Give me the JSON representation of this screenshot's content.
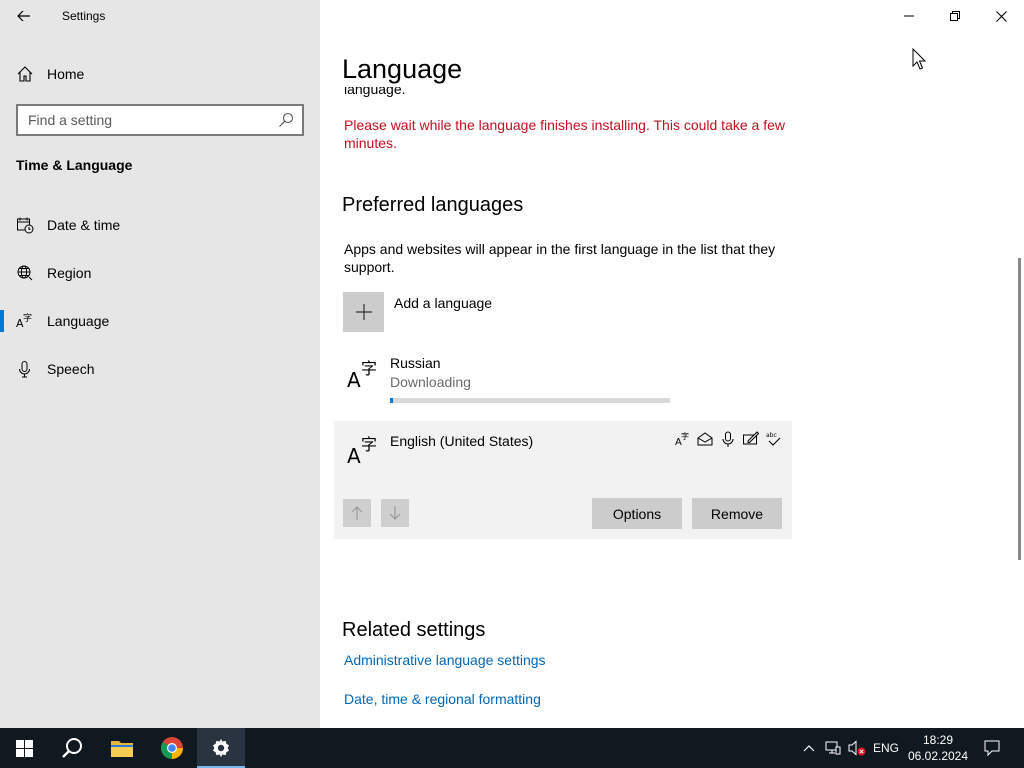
{
  "window": {
    "title": "Settings"
  },
  "nav": {
    "home_label": "Home",
    "search_placeholder": "Find a setting",
    "section_title": "Time & Language",
    "items": [
      {
        "label": "Date & time",
        "icon": "calendar-clock-icon"
      },
      {
        "label": "Region",
        "icon": "globe-icon"
      },
      {
        "label": "Language",
        "icon": "language-icon",
        "selected": true
      },
      {
        "label": "Speech",
        "icon": "microphone-icon"
      }
    ]
  },
  "main": {
    "title": "Language",
    "clipped_text": "language.",
    "warning": "Please wait while the language finishes installing. This could take a few minutes.",
    "preferred": {
      "heading": "Preferred languages",
      "description": "Apps and websites will appear in the first language in the list that they support.",
      "add_label": "Add a language",
      "languages": [
        {
          "name": "Russian",
          "status": "Downloading",
          "progress": 0.01
        },
        {
          "name": "English (United States)",
          "features": [
            "display-language-icon",
            "text-to-speech-icon",
            "speech-icon",
            "handwriting-icon",
            "spellcheck-icon"
          ]
        }
      ],
      "options_label": "Options",
      "remove_label": "Remove"
    },
    "related": {
      "heading": "Related settings",
      "links": [
        "Administrative language settings",
        "Date, time & regional formatting"
      ]
    }
  },
  "taskbar": {
    "apps": [
      "start-icon",
      "search-icon",
      "file-explorer-icon",
      "chrome-icon",
      "settings-icon"
    ],
    "input_language": "ENG",
    "time": "18:29",
    "date": "06.02.2024"
  },
  "colors": {
    "accent": "#0078d7",
    "warning": "#c50f1f",
    "link": "#0067b8",
    "nav_bg": "#e6e6e6",
    "taskbar_bg": "#101820"
  }
}
